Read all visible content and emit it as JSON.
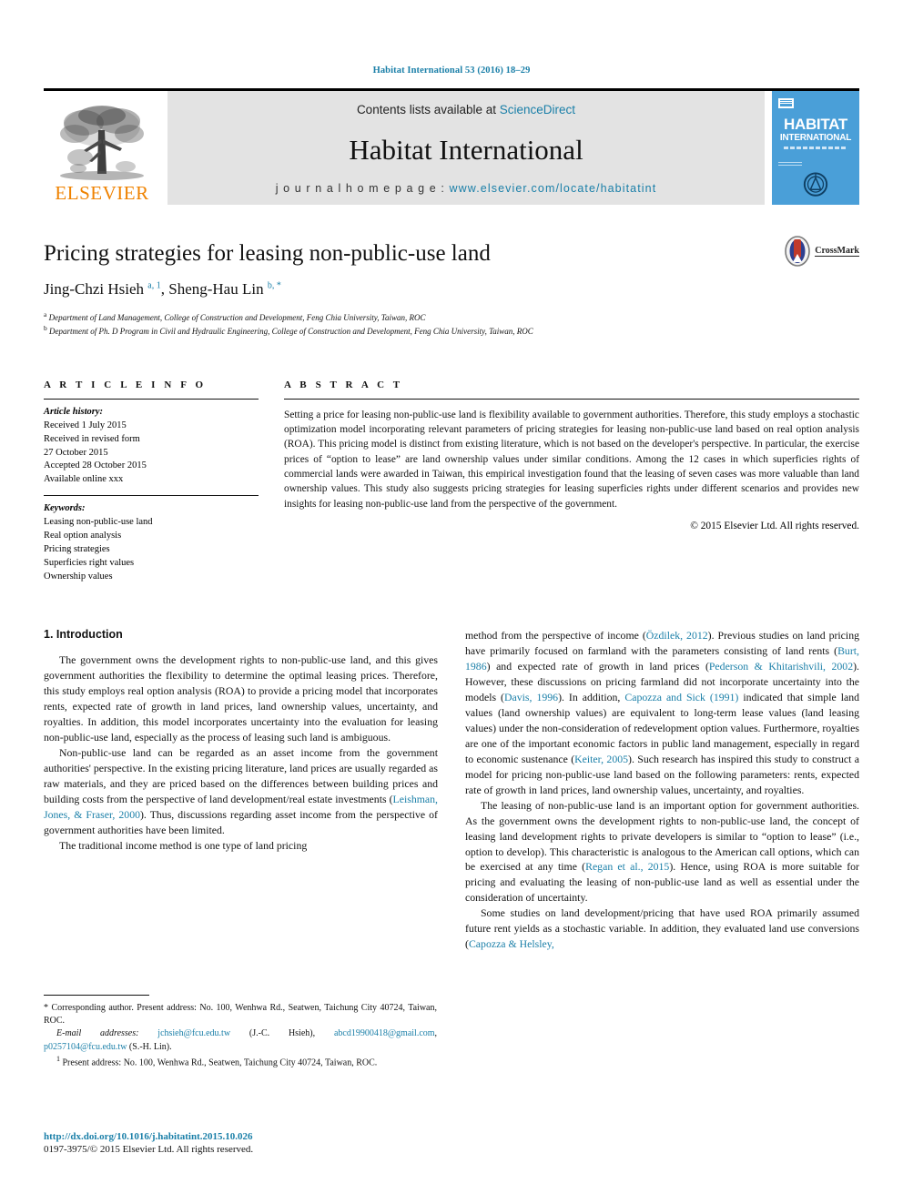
{
  "running_head": "Habitat International 53 (2016) 18–29",
  "masthead": {
    "publisher_name": "ELSEVIER",
    "contents_prefix": "Contents lists available at ",
    "contents_link": "ScienceDirect",
    "journal_name": "Habitat International",
    "homepage_prefix": "j o u r n a l  h o m e p a g e :  ",
    "homepage_url": "www.elsevier.com/locate/habitatint",
    "cover": {
      "title_line1": "HABITAT",
      "title_line2": "INTERNATIONAL"
    }
  },
  "article": {
    "title": "Pricing strategies for leasing non-public-use land",
    "authors_html": "Jing-Chzi Hsieh <sup>a, 1</sup>, Sheng-Hau Lin <sup>b, *</sup>",
    "affiliation_a": "Department of Land Management, College of Construction and Development, Feng Chia University, Taiwan, ROC",
    "affiliation_b": "Department of Ph. D Program in Civil and Hydraulic Engineering, College of Construction and Development, Feng Chia University, Taiwan, ROC",
    "crossmark_label": "CrossMark"
  },
  "article_info": {
    "heading": "A R T I C L E  I N F O",
    "history_label": "Article history:",
    "history": [
      "Received 1 July 2015",
      "Received in revised form",
      "27 October 2015",
      "Accepted 28 October 2015",
      "Available online xxx"
    ],
    "keywords_label": "Keywords:",
    "keywords": [
      "Leasing non-public-use land",
      "Real option analysis",
      "Pricing strategies",
      "Superficies right values",
      "Ownership values"
    ]
  },
  "abstract": {
    "heading": "A B S T R A C T",
    "text": "Setting a price for leasing non-public-use land is flexibility available to government authorities. Therefore, this study employs a stochastic optimization model incorporating relevant parameters of pricing strategies for leasing non-public-use land based on real option analysis (ROA). This pricing model is distinct from existing literature, which is not based on the developer's perspective. In particular, the exercise prices of “option to lease” are land ownership values under similar conditions. Among the 12 cases in which superficies rights of commercial lands were awarded in Taiwan, this empirical investigation found that the leasing of seven cases was more valuable than land ownership values. This study also suggests pricing strategies for leasing superficies rights under different scenarios and provides new insights for leasing non-public-use land from the perspective of the government.",
    "copyright": "© 2015 Elsevier Ltd. All rights reserved."
  },
  "body": {
    "section_title": "1. Introduction",
    "left_paragraphs": [
      "The government owns the development rights to non-public-use land, and this gives government authorities the flexibility to determine the optimal leasing prices. Therefore, this study employs real option analysis (ROA) to provide a pricing model that incorporates rents, expected rate of growth in land prices, land ownership values, uncertainty, and royalties. In addition, this model incorporates uncertainty into the evaluation for leasing non-public-use land, especially as the process of leasing such land is ambiguous.",
      "Non-public-use land can be regarded as an asset income from the government authorities' perspective. In the existing pricing literature, land prices are usually regarded as raw materials, and they are priced based on the differences between building prices and building costs from the perspective of land development/real estate investments (Leishman, Jones, & Fraser, 2000). Thus, discussions regarding asset income from the perspective of government authorities have been limited.",
      "The traditional income method is one type of land pricing"
    ],
    "right_paragraphs": [
      "method from the perspective of income (Özdilek, 2012). Previous studies on land pricing have primarily focused on farmland with the parameters consisting of land rents (Burt, 1986) and expected rate of growth in land prices (Pederson & Khitarishvili, 2002). However, these discussions on pricing farmland did not incorporate uncertainty into the models (Davis, 1996). In addition, Capozza and Sick (1991) indicated that simple land values (land ownership values) are equivalent to long-term lease values (land leasing values) under the non-consideration of redevelopment option values. Furthermore, royalties are one of the important economic factors in public land management, especially in regard to economic sustenance (Keiter, 2005). Such research has inspired this study to construct a model for pricing non-public-use land based on the following parameters: rents, expected rate of growth in land prices, land ownership values, uncertainty, and royalties.",
      "The leasing of non-public-use land is an important option for government authorities. As the government owns the development rights to non-public-use land, the concept of leasing land development rights to private developers is similar to “option to lease” (i.e., option to develop). This characteristic is analogous to the American call options, which can be exercised at any time (Regan et al., 2015). Hence, using ROA is more suitable for pricing and evaluating the leasing of non-public-use land as well as essential under the consideration of uncertainty.",
      "Some studies on land development/pricing that have used ROA primarily assumed future rent yields as a stochastic variable. In addition, they evaluated land use conversions (Capozza & Helsley,"
    ],
    "references_inline": [
      "Leishman, Jones, & Fraser, 2000",
      "Özdilek, 2012",
      "Burt, 1986",
      "Pederson & Khitarishvili, 2002",
      "Davis, 1996",
      "Capozza and Sick (1991)",
      "Keiter, 2005",
      "Regan et al., 2015",
      "Capozza & Helsley,"
    ]
  },
  "footnotes": {
    "corresponding": "* Corresponding author. Present address: No. 100, Wenhwa Rd., Seatwen, Taichung City 40724, Taiwan, ROC.",
    "email_label": "E-mail addresses:",
    "email_1": "jchsieh@fcu.edu.tw",
    "email_1_owner": "(J.-C. Hsieh),",
    "email_2": "abcd19900418@gmail.com",
    "email_3": "p0257104@fcu.edu.tw",
    "email_3_owner": "(S.-H. Lin).",
    "present_address": "Present address: No. 100, Wenhwa Rd., Seatwen, Taichung City 40724, Taiwan, ROC.",
    "present_address_marker": "1"
  },
  "footer": {
    "doi": "http://dx.doi.org/10.1016/j.habitatint.2015.10.026",
    "issn": "0197-3975/© 2015 Elsevier Ltd. All rights reserved."
  },
  "colors": {
    "link": "#1a7fa8",
    "elsevier_orange": "#ef8200",
    "cover_blue": "#4a9fd8",
    "masthead_grey": "#e3e3e3"
  }
}
